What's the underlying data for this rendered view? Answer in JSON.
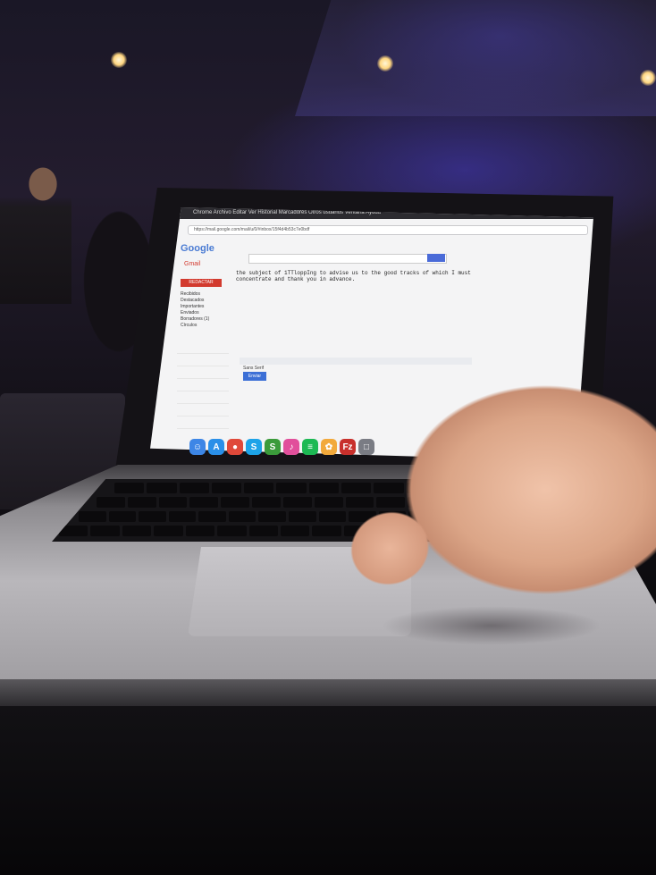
{
  "scene": {
    "description_hidden": false
  },
  "browser": {
    "url": "https://mail.google.com/mail/u/0/#inbox/15f4d4b53c7e0bdf",
    "menu": [
      "Chrome",
      "Archivo",
      "Editar",
      "Ver",
      "Historial",
      "Marcadores",
      "Otros usuarios",
      "Ventana",
      "Ayuda"
    ]
  },
  "gmail": {
    "logo": "Google",
    "app_label": "Gmail",
    "compose_label": "REDACTAR",
    "sidebar": [
      "Recibidos",
      "Destacados",
      "Importantes",
      "Enviados",
      "Borradores (1)",
      "Círculos"
    ],
    "subject_text": "the subject of 1TTloppIng to advise us to the good tracks of which I must concentrate and thank you in advance.",
    "send_label": "Enviar",
    "toolbar_text": "Sans Serif"
  },
  "dock": {
    "icons": [
      {
        "name": "finder-icon",
        "color": "#3d86e6",
        "glyph": "☺"
      },
      {
        "name": "appstore-icon",
        "color": "#2a8fe8",
        "glyph": "A"
      },
      {
        "name": "chrome-icon",
        "color": "#e0493a",
        "glyph": "●"
      },
      {
        "name": "skype-icon",
        "color": "#1da3e8",
        "glyph": "S"
      },
      {
        "name": "scrivener-icon",
        "color": "#3b9b3b",
        "glyph": "S"
      },
      {
        "name": "itunes-icon",
        "color": "#e14f9b",
        "glyph": "♪"
      },
      {
        "name": "spotify-icon",
        "color": "#1db954",
        "glyph": "≡"
      },
      {
        "name": "photos-icon",
        "color": "#f2a93b",
        "glyph": "✿"
      },
      {
        "name": "filezilla-icon",
        "color": "#c8302c",
        "glyph": "Fz"
      },
      {
        "name": "trash-icon",
        "color": "#7a7c84",
        "glyph": "□"
      }
    ]
  }
}
